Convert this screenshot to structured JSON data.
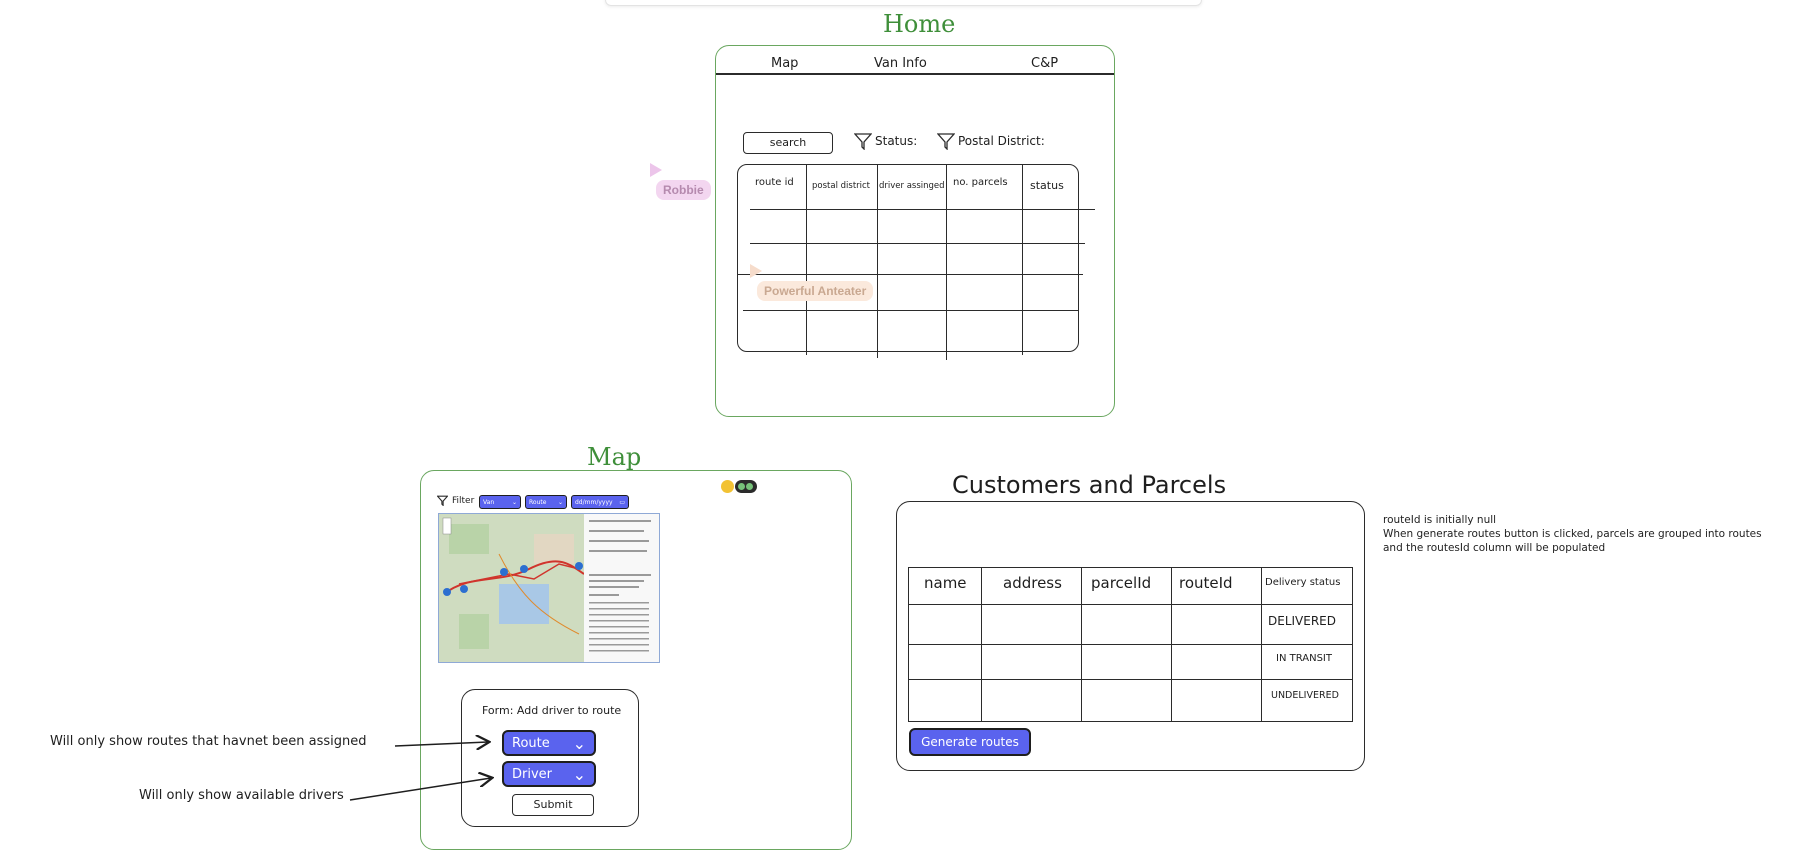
{
  "home": {
    "title": "Home",
    "nav": [
      "Map",
      "Van Info",
      "C&P"
    ],
    "search_label": "search",
    "status_filter": "Status:",
    "district_filter": "Postal District:",
    "columns": [
      "route id",
      "postal district",
      "driver assinged",
      "no. parcels",
      "status"
    ]
  },
  "collaborators": {
    "robbie": "Robbie",
    "anteater": "Powerful Anteater"
  },
  "map": {
    "title": "Map",
    "filter_label": "Filter",
    "filter_selects": [
      "Van",
      "Route",
      "dd/mm/yyyy"
    ],
    "form_title": "Form: Add driver to route",
    "route_select": "Route",
    "driver_select": "Driver",
    "submit_label": "Submit"
  },
  "annotations": {
    "routes_note": "Will only show routes that havnet been assigned",
    "drivers_note": "Will only show available drivers"
  },
  "cp": {
    "title": "Customers and Parcels",
    "columns": [
      "name",
      "address",
      "parcelId",
      "routeId",
      "Delivery status"
    ],
    "statuses": [
      "DELIVERED",
      "IN TRANSIT",
      "UNDELIVERED"
    ],
    "generate_label": "Generate routes",
    "note_lines": [
      "routeId is initially null",
      "When generate routes button is clicked, parcels are grouped into routes",
      "and the routesId column will be populated"
    ]
  },
  "colors": {
    "frame_green": "#6aa760",
    "title_green": "#3f8f3a",
    "button_blue": "#5a63ee",
    "robbie_tag": "#f3d6f0",
    "anteater_tag": "#fbe9dc"
  }
}
